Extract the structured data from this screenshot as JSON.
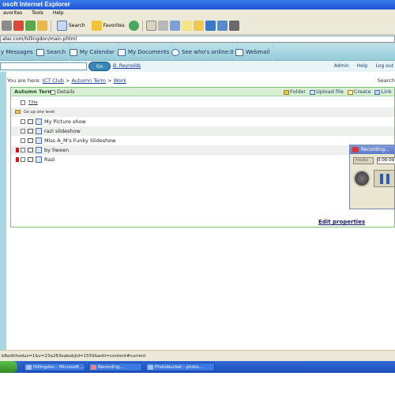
{
  "window": {
    "title": "osoft Internet Explorer"
  },
  "menu": [
    "avorites",
    "Tools",
    "Help"
  ],
  "toolbar": {
    "search_label": "Search",
    "favorites_label": "Favorites"
  },
  "address": {
    "url": "ater.com/hillingdon/main.phtml"
  },
  "nav": {
    "items": [
      "y Messages",
      "Search",
      "My Calendar",
      "My Documents",
      "See who's online:0",
      "Webmail"
    ]
  },
  "subbar": {
    "go_label": "Go",
    "user": "B. Reynolds",
    "admin": "Admin",
    "help": "Help",
    "logout": "Log out"
  },
  "breadcrumb": {
    "prefix": "You are here:",
    "crumbs": [
      "ICT Club",
      "Autumn Term",
      "Work"
    ],
    "sep": ">",
    "search": "Search"
  },
  "panel": {
    "title": "Autumn Term",
    "details_label": "Details",
    "actions": [
      "Folder",
      "Upload file",
      "Create",
      "Link"
    ],
    "header_title": "Title",
    "up_level": "Go up one level",
    "rows": [
      {
        "name": "My Picture show",
        "flag": false
      },
      {
        "name": "razi slideshow",
        "flag": false
      },
      {
        "name": "Miss A_M's Funky Slideshow",
        "flag": false
      },
      {
        "name": "by llween",
        "flag": true
      },
      {
        "name": "Razi",
        "flag": true
      }
    ],
    "edit_properties": "Edit properties"
  },
  "recorder": {
    "title": "Recording...",
    "time": "0:00:09",
    "select": "media"
  },
  "status": {
    "text": "b6edithodus=1&v=23a263eabobjid=1559&edit=content#current"
  },
  "taskbar": {
    "tasks": [
      "Hillingdon - Microsoft ...",
      "Recording...",
      "Photobucket - photo..."
    ]
  },
  "colors": {
    "nav_bg": "#bde2ea",
    "panel_border": "#7cc07a",
    "taskbar": "#1c4fba"
  }
}
